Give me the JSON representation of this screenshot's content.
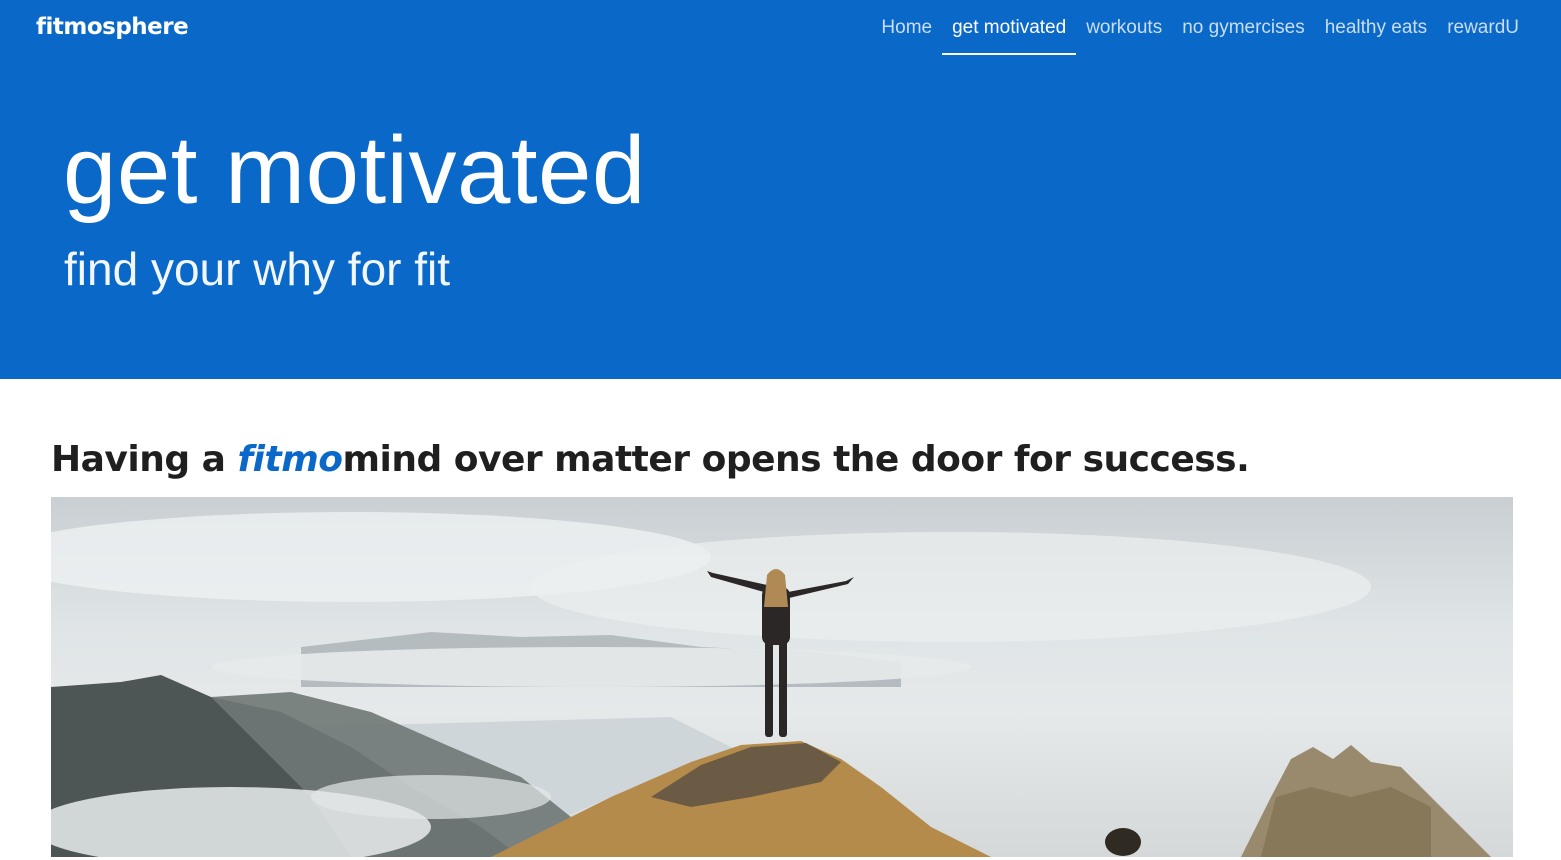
{
  "brand": "fitmosphere",
  "nav": {
    "items": [
      {
        "label": "Home"
      },
      {
        "label": "get motivated",
        "active": true
      },
      {
        "label": "workouts"
      },
      {
        "label": "no gymercises"
      },
      {
        "label": "healthy eats"
      },
      {
        "label": "rewardU"
      }
    ]
  },
  "hero": {
    "title": "get motivated",
    "subtitle": "find your why for fit"
  },
  "content": {
    "headline_prefix": "Having a ",
    "headline_accent": "fitmo",
    "headline_suffix": "mind over matter opens the door for success."
  },
  "colors": {
    "brand_blue": "#0a68c9",
    "text_dark": "#1f1f1f"
  }
}
